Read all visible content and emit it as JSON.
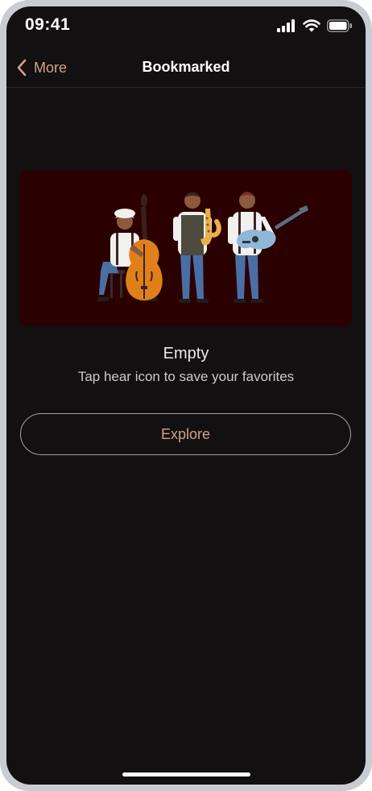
{
  "status_bar": {
    "time": "09:41",
    "icons": [
      "cellular-signal-icon",
      "wifi-icon",
      "battery-icon"
    ]
  },
  "nav": {
    "back_label": "More",
    "title": "Bookmarked"
  },
  "empty_state": {
    "illustration": "musicians-illustration",
    "title": "Empty",
    "subtitle": "Tap hear icon to save your favorites"
  },
  "actions": {
    "explore_label": "Explore"
  },
  "colors": {
    "background": "#121010",
    "accent": "#d4a08a",
    "hero_background": "#2b0000",
    "text_primary": "#ffffff"
  }
}
